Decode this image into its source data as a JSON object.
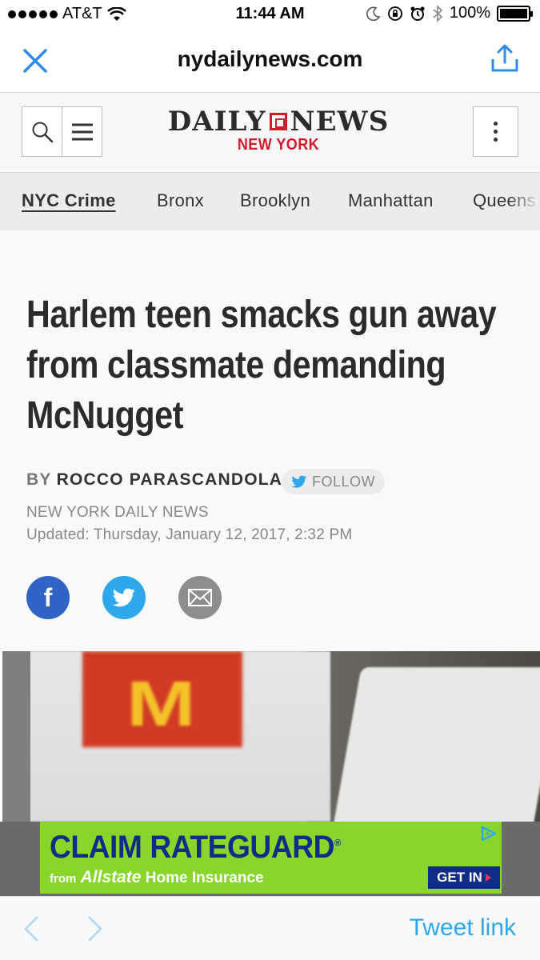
{
  "status_bar": {
    "carrier": "AT&T",
    "time": "11:44 AM",
    "battery_percent": "100%",
    "battery_level": 1.0
  },
  "browser": {
    "url": "nydailynews.com",
    "close_icon": "close-icon",
    "share_icon": "share-icon"
  },
  "site_header": {
    "logo_main_left": "DAILY",
    "logo_main_right": "NEWS",
    "logo_sub": "NEW YORK",
    "search_icon": "search-icon",
    "menu_icon": "hamburger-menu-icon",
    "more_icon": "more-vertical-icon"
  },
  "section_nav": {
    "items": [
      "NYC Crime",
      "Bronx",
      "Brooklyn",
      "Manhattan",
      "Queens"
    ],
    "active_index": 0
  },
  "article": {
    "headline": "Harlem teen smacks gun away from classmate demanding McNugget",
    "by_label": "BY",
    "author": "ROCCO PARASCANDOLA",
    "follow_label": "FOLLOW",
    "source": "NEW YORK DAILY NEWS",
    "updated": "Updated: Thursday, January 12, 2017, 2:32 PM",
    "share": {
      "facebook_glyph": "f",
      "facebook_icon": "facebook-icon",
      "twitter_icon": "twitter-icon",
      "email_icon": "email-icon"
    },
    "photo_alt": "McDonald's bag"
  },
  "ad": {
    "title": "CLAIM RATEGUARD",
    "trademark": "®",
    "from_label": "from",
    "brand": "Allstate",
    "product": "Home Insurance",
    "cta": "GET IN"
  },
  "toolbar": {
    "back_icon": "chevron-left-icon",
    "forward_icon": "chevron-right-icon",
    "tweet_link": "Tweet link"
  },
  "colors": {
    "brand_red": "#d2182b",
    "link_blue": "#2ea7ec",
    "facebook_blue": "#2f63c4",
    "ad_green": "#88d62b",
    "ad_navy": "#0f2d86"
  }
}
